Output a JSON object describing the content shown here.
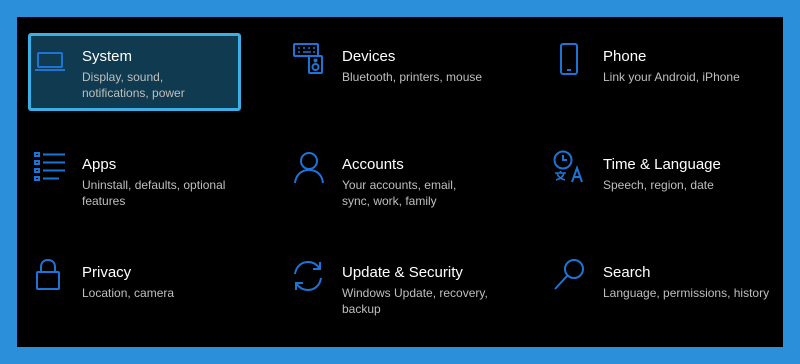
{
  "settings": {
    "accent_color": "#1e74d6",
    "selected_border_color": "#3bb0e6",
    "tiles": [
      {
        "title": "System",
        "description": "Display, sound, notifications, power",
        "icon": "laptop-icon",
        "selected": true
      },
      {
        "title": "Devices",
        "description": "Bluetooth, printers, mouse",
        "icon": "keyboard-speaker-icon",
        "selected": false
      },
      {
        "title": "Phone",
        "description": "Link your Android, iPhone",
        "icon": "phone-icon",
        "selected": false
      },
      {
        "title": "Apps",
        "description": "Uninstall, defaults, optional features",
        "icon": "apps-list-icon",
        "selected": false
      },
      {
        "title": "Accounts",
        "description": "Your accounts, email, sync, work, family",
        "icon": "person-icon",
        "selected": false
      },
      {
        "title": "Time & Language",
        "description": "Speech, region, date",
        "icon": "time-language-icon",
        "selected": false
      },
      {
        "title": "Privacy",
        "description": "Location, camera",
        "icon": "lock-icon",
        "selected": false
      },
      {
        "title": "Update & Security",
        "description": "Windows Update, recovery, backup",
        "icon": "sync-arrows-icon",
        "selected": false
      },
      {
        "title": "Search",
        "description": "Language, permissions, history",
        "icon": "search-icon",
        "selected": false
      }
    ]
  }
}
